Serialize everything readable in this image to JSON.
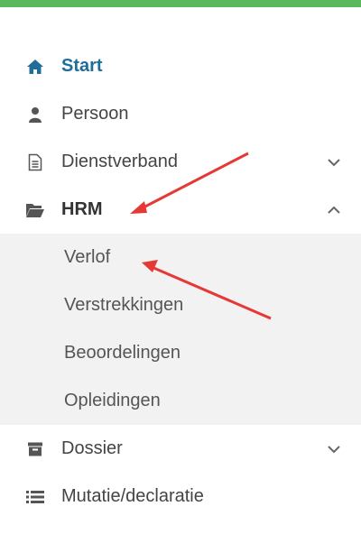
{
  "accent_color": "#5cb85c",
  "menu": {
    "items": [
      {
        "label": "Start",
        "icon": "home-icon"
      },
      {
        "label": "Persoon",
        "icon": "user-icon"
      },
      {
        "label": "Dienstverband",
        "icon": "document-icon"
      },
      {
        "label": "HRM",
        "icon": "folder-open-icon"
      }
    ],
    "hrm_submenu": [
      "Verlof",
      "Verstrekkingen",
      "Beoordelingen",
      "Opleidingen"
    ],
    "after_items": [
      {
        "label": "Dossier",
        "icon": "archive-icon"
      },
      {
        "label": "Mutatie/declaratie",
        "icon": "list-icon"
      }
    ]
  }
}
